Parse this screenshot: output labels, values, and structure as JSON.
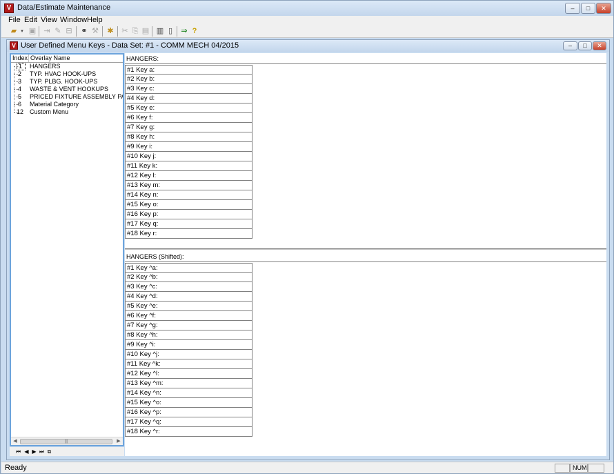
{
  "app": {
    "title": "Data/Estimate Maintenance",
    "icon": "V"
  },
  "window_controls": {
    "minimize": "–",
    "maximize": "□",
    "close": "✕"
  },
  "menu": [
    "File",
    "Edit",
    "View",
    "Window",
    "Help"
  ],
  "toolbar": [
    "open-icon",
    "save-icon",
    "cut-column-icon",
    "edit-icon",
    "print-setup-icon",
    "binoculars-icon",
    "tools-icon",
    "star-icon",
    "cut-icon",
    "copy-icon",
    "paste-icon",
    "print-icon",
    "preview-icon",
    "exit-icon",
    "help-icon"
  ],
  "child_window": {
    "title": "User Defined Menu Keys - Data Set: #1 - COMM MECH 04/2015",
    "icon": "V"
  },
  "tree": {
    "header": {
      "index": "Index",
      "name": "Overlay Name"
    },
    "items": [
      {
        "index": "1",
        "name": "HANGERS",
        "selected": true
      },
      {
        "index": "2",
        "name": "TYP. HVAC HOOK-UPS"
      },
      {
        "index": "3",
        "name": "TYP. PLBG. HOOK-UPS"
      },
      {
        "index": "4",
        "name": "WASTE & VENT HOOKUPS"
      },
      {
        "index": "5",
        "name": "PRICED FIXTURE ASSEMBLY PACKA"
      },
      {
        "index": "6",
        "name": "Material Category"
      },
      {
        "index": "12",
        "name": "Custom Menu"
      }
    ],
    "scroll_thumb": "|||"
  },
  "nav": [
    "⏮",
    "◀",
    "▶",
    "⏭",
    "⧉"
  ],
  "sections": [
    {
      "label": "HANGERS:",
      "keys": [
        "#1 Key a:",
        "#2 Key b:",
        "#3 Key c:",
        "#4 Key d:",
        "#5 Key e:",
        "#6 Key f:",
        "#7 Key g:",
        "#8 Key h:",
        "#9 Key i:",
        "#10 Key j:",
        "#11 Key k:",
        "#12 Key l:",
        "#13 Key m:",
        "#14 Key n:",
        "#15 Key o:",
        "#16 Key p:",
        "#17 Key q:",
        "#18 Key r:"
      ]
    },
    {
      "label": "HANGERS (Shifted):",
      "keys": [
        "#1 Key ^a:",
        "#2 Key ^b:",
        "#3 Key ^c:",
        "#4 Key ^d:",
        "#5 Key ^e:",
        "#6 Key ^f:",
        "#7 Key ^g:",
        "#8 Key ^h:",
        "#9 Key ^i:",
        "#10 Key ^j:",
        "#11 Key ^k:",
        "#12 Key ^l:",
        "#13 Key ^m:",
        "#14 Key ^n:",
        "#15 Key ^o:",
        "#16 Key ^p:",
        "#17 Key ^q:",
        "#18 Key ^r:"
      ]
    }
  ],
  "status": {
    "text": "Ready",
    "num": "NUM"
  }
}
